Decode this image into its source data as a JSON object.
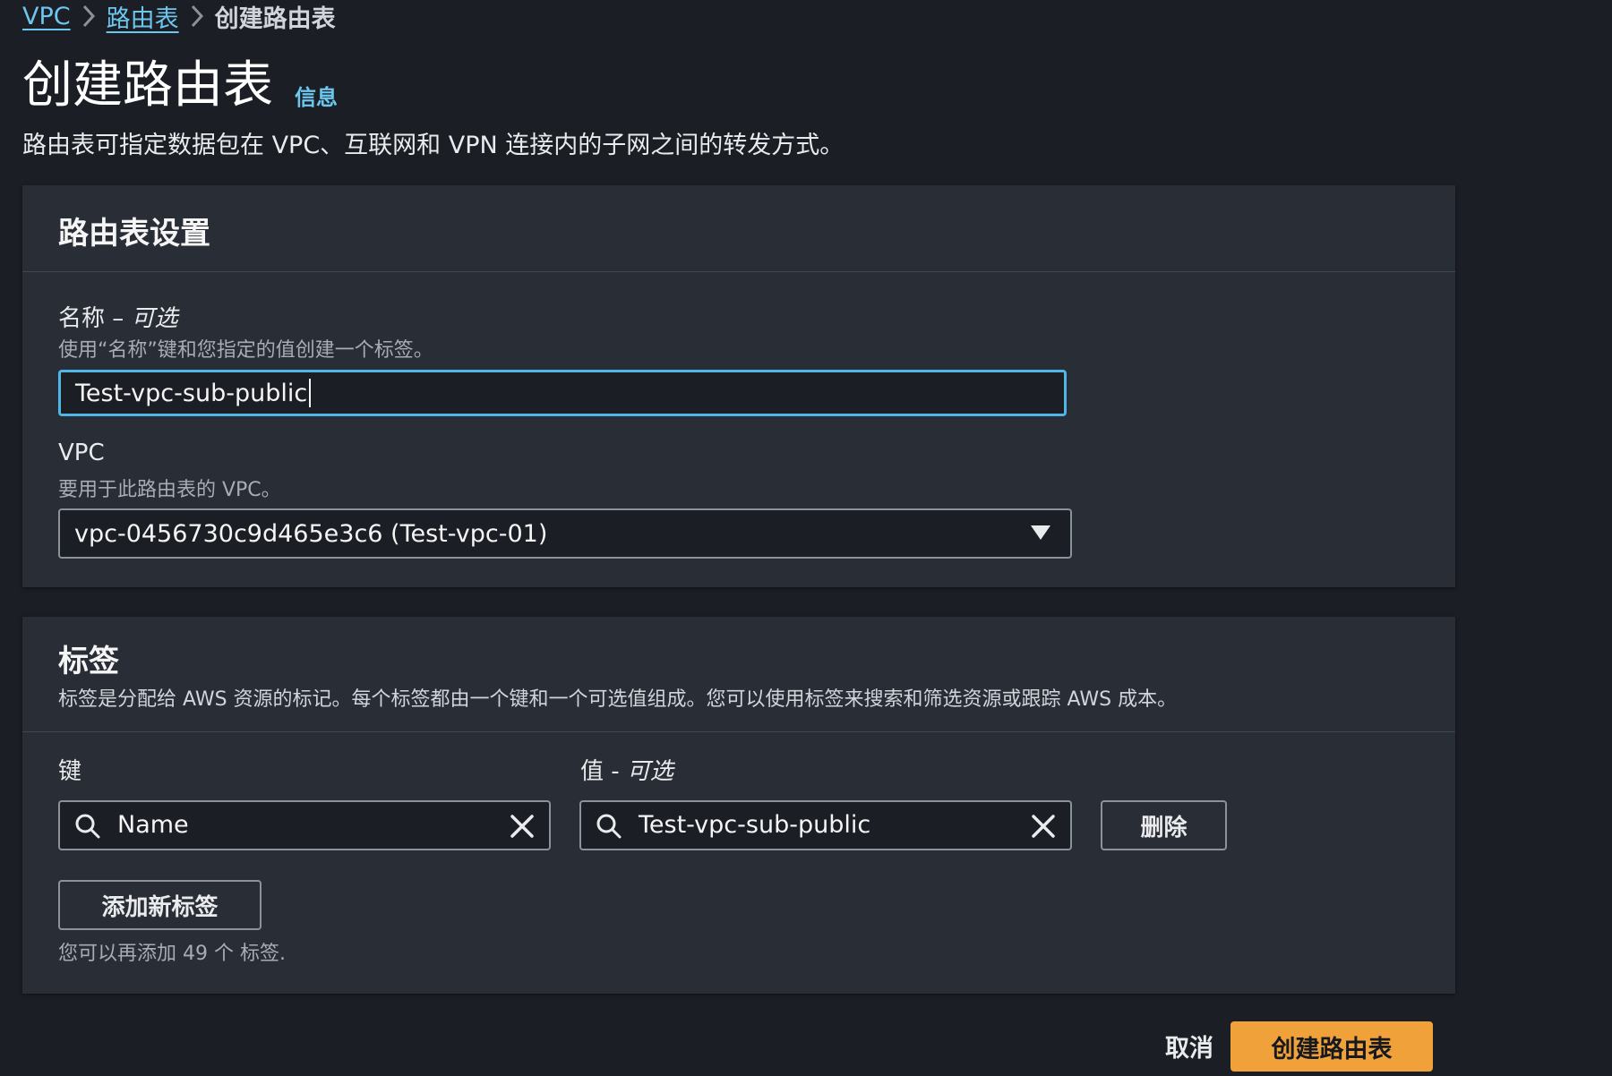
{
  "breadcrumb": {
    "items": [
      "VPC",
      "路由表"
    ],
    "current": "创建路由表"
  },
  "header": {
    "title": "创建路由表",
    "info": "信息",
    "description": "路由表可指定数据包在 VPC、互联网和 VPN 连接内的子网之间的转发方式。"
  },
  "settings": {
    "title": "路由表设置",
    "name_label": "名称 – ",
    "name_optional": "可选",
    "name_desc": "使用“名称”键和您指定的值创建一个标签。",
    "name_value": "Test-vpc-sub-public",
    "vpc_label": "VPC",
    "vpc_desc": "要用于此路由表的 VPC。",
    "vpc_value": "vpc-0456730c9d465e3c6 (Test-vpc-01)"
  },
  "tags": {
    "title": "标签",
    "description": "标签是分配给 AWS 资源的标记。每个标签都由一个键和一个可选值组成。您可以使用标签来搜索和筛选资源或跟踪 AWS 成本。",
    "key_label": "键",
    "value_label": "值 - ",
    "value_optional": "可选",
    "key_value": "Name",
    "value_value": "Test-vpc-sub-public",
    "remove_label": "删除",
    "add_label": "添加新标签",
    "hint": "您可以再添加 49 个 标签."
  },
  "footer": {
    "cancel": "取消",
    "create": "创建路由表"
  },
  "colors": {
    "accent": "#4fb6e5",
    "primary_button": "#f1a13a",
    "link": "#6cc7ef"
  },
  "icons": [
    "chevron-right-icon",
    "search-icon",
    "close-icon",
    "caret-down-icon"
  ]
}
